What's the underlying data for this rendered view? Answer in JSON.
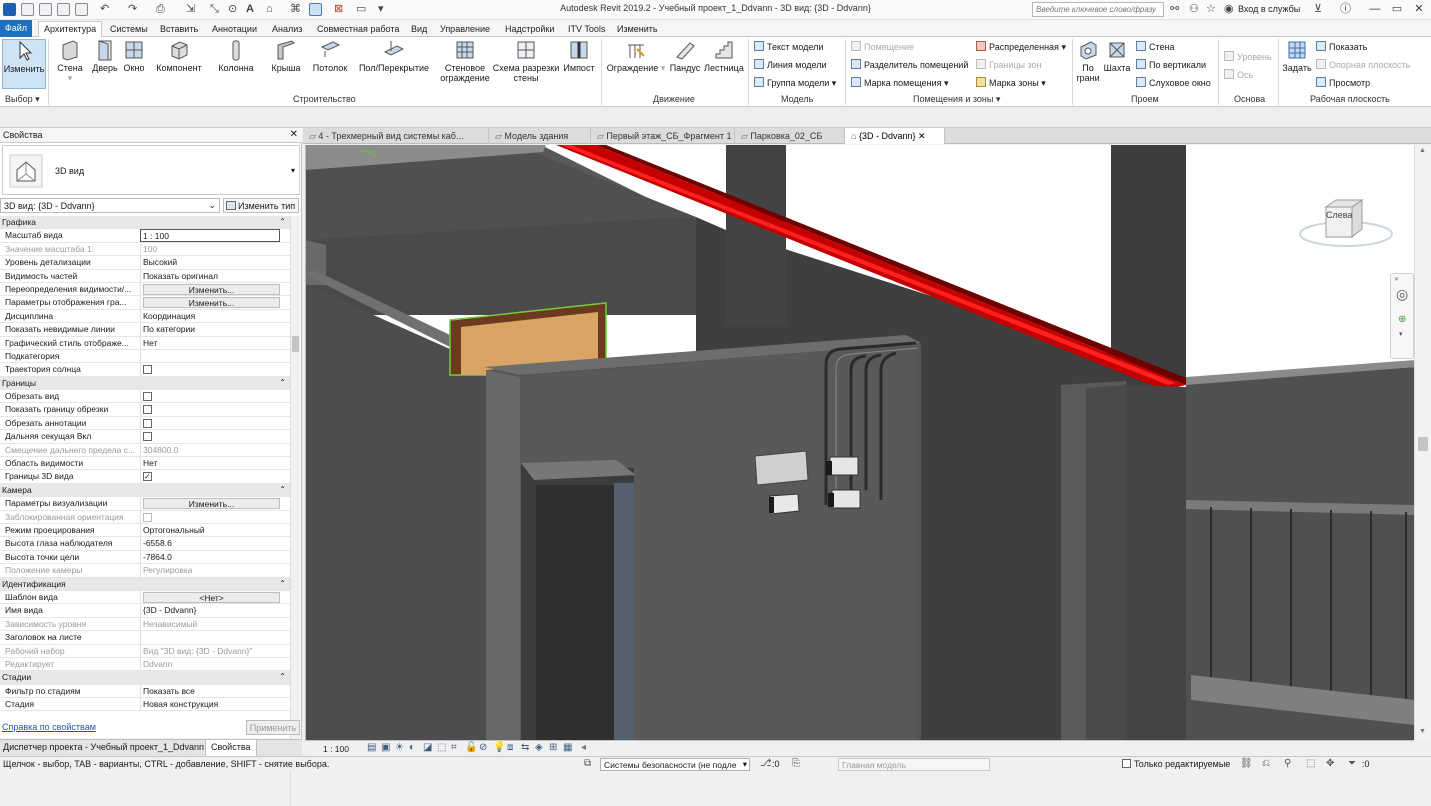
{
  "app": {
    "title": "Autodesk Revit 2019.2 - Учебный проект_1_Ddvann - 3D вид: {3D - Ddvann}",
    "search_placeholder": "Введите ключевое слово/фразу",
    "sign_in": "Вход в службы",
    "accent": "#1e6fc0"
  },
  "ribbon_tabs": [
    "Файл",
    "Архитектура",
    "Системы",
    "Вставить",
    "Аннотации",
    "Анализ",
    "Совместная работа",
    "Вид",
    "Управление",
    "Надстройки",
    "ITV Tools",
    "Изменить"
  ],
  "ribbon": {
    "select_group": "Выбор",
    "modify_label": "Изменить",
    "build": {
      "group": "Строительство",
      "items": [
        "Стена",
        "Дверь",
        "Окно",
        "Компонент",
        "Колонна",
        "Крыша",
        "Потолок",
        "Пол/Перекрытие",
        "Стеновое ограждение",
        "Схема разрезки стены",
        "Импост"
      ]
    },
    "circulation": {
      "group": "Движение",
      "items": [
        "Ограждение",
        "Пандус",
        "Лестница"
      ]
    },
    "model": {
      "group": "Модель",
      "items": [
        "Текст модели",
        "Линия модели",
        "Группа модели"
      ]
    },
    "rooms": {
      "group": "Помещения и зоны",
      "items": [
        "Помещение",
        "Разделитель помещений",
        "Марка помещения",
        "Распределенная",
        "Границы зон",
        "Марка зоны"
      ]
    },
    "opening": {
      "group": "Проем",
      "items": [
        "По грани",
        "Шахта",
        "Стена",
        "По вертикали",
        "Слуховое окно"
      ]
    },
    "datum": {
      "group": "Основа",
      "items": [
        "Уровень",
        "Ось"
      ]
    },
    "workplane": {
      "group": "Рабочая плоскость",
      "items": [
        "Задать",
        "Показать",
        "Опорная плоскость",
        "Просмотр"
      ]
    }
  },
  "properties": {
    "header": "Свойства",
    "type_name": "3D вид",
    "view_selector": "3D вид: {3D - Ddvann}",
    "edit_type": "Изменить тип",
    "help_link": "Справка по свойствам",
    "apply": "Применить",
    "rows": [
      {
        "cat": true,
        "name": "Графика"
      },
      {
        "name": "Масштаб вида",
        "value": "1 : 100",
        "input": true
      },
      {
        "name": "Значение масштаба    1:",
        "value": "100",
        "ro": true
      },
      {
        "name": "Уровень детализации",
        "value": "Высокий"
      },
      {
        "name": "Видимость частей",
        "value": "Показать оригинал"
      },
      {
        "name": "Переопределения видимости/...",
        "value": "Изменить...",
        "button": true
      },
      {
        "name": "Параметры отображения гра...",
        "value": "Изменить...",
        "button": true
      },
      {
        "name": "Дисциплина",
        "value": "Координация"
      },
      {
        "name": "Показать невидимые линии",
        "value": "По категории"
      },
      {
        "name": "Графический стиль отображе...",
        "value": "Нет"
      },
      {
        "name": "Подкатегория",
        "value": ""
      },
      {
        "name": "Траектория солнца",
        "value": "",
        "check": false
      },
      {
        "cat": true,
        "name": "Границы"
      },
      {
        "name": "Обрезать вид",
        "value": "",
        "check": false
      },
      {
        "name": "Показать границу обрезки",
        "value": "",
        "check": false
      },
      {
        "name": "Обрезать аннотации",
        "value": "",
        "check": false
      },
      {
        "name": "Дальняя секущая Вкл",
        "value": "",
        "check": false
      },
      {
        "name": "Смещение дальнего предела с...",
        "value": "304800.0",
        "ro": true
      },
      {
        "name": "Область видимости",
        "value": "Нет"
      },
      {
        "name": "Границы 3D вида",
        "value": "",
        "check": true
      },
      {
        "cat": true,
        "name": "Камера"
      },
      {
        "name": "Параметры визуализации",
        "value": "Изменить...",
        "button": true
      },
      {
        "name": "Заблокированная ориентация",
        "value": "",
        "check": false,
        "ro": true
      },
      {
        "name": "Режим проецирования",
        "value": "Ортогональный"
      },
      {
        "name": "Высота глаза наблюдателя",
        "value": "-6558.6"
      },
      {
        "name": "Высота точки цели",
        "value": "-7864.0"
      },
      {
        "name": "Положение камеры",
        "value": "Регулировка",
        "ro": true
      },
      {
        "cat": true,
        "name": "Идентификация"
      },
      {
        "name": "Шаблон вида",
        "value": "<Нет>",
        "button": true
      },
      {
        "name": "Имя вида",
        "value": "{3D - Ddvann}"
      },
      {
        "name": "Зависимость уровня",
        "value": "Независимый",
        "ro": true
      },
      {
        "name": "Заголовок на листе",
        "value": ""
      },
      {
        "name": "Рабочий набор",
        "value": "Вид \"3D вид: {3D - Ddvann}\"",
        "ro": true
      },
      {
        "name": "Редактирует",
        "value": "Ddvann",
        "ro": true
      },
      {
        "cat": true,
        "name": "Стадии"
      },
      {
        "name": "Фильтр по стадиям",
        "value": "Показать все"
      },
      {
        "name": "Стадия",
        "value": "Новая конструкция"
      }
    ]
  },
  "bottom_tabs": [
    "Диспетчер проекта - Учебный проект_1_Ddvann",
    "Свойства"
  ],
  "doc_tabs": [
    {
      "label": "4 - Трехмерный вид системы каб..."
    },
    {
      "label": "Модель здания"
    },
    {
      "label": "Первый этаж_СБ_Фрагмент 1"
    },
    {
      "label": "Парковка_02_СБ"
    },
    {
      "label": "{3D - Ddvann}",
      "active": true
    }
  ],
  "viewcube_label": "Слева",
  "view_scale": "1 : 100",
  "status": {
    "hint": "Щелчок - выбор, TAB - варианты, CTRL - добавление, SHIFT - снятие выбора.",
    "workset": "Системы безопасности (не подле",
    "zero": ":0",
    "design_option": "Главная модель",
    "editable_only": "Только редактируемые",
    "filter_count": ":0"
  }
}
